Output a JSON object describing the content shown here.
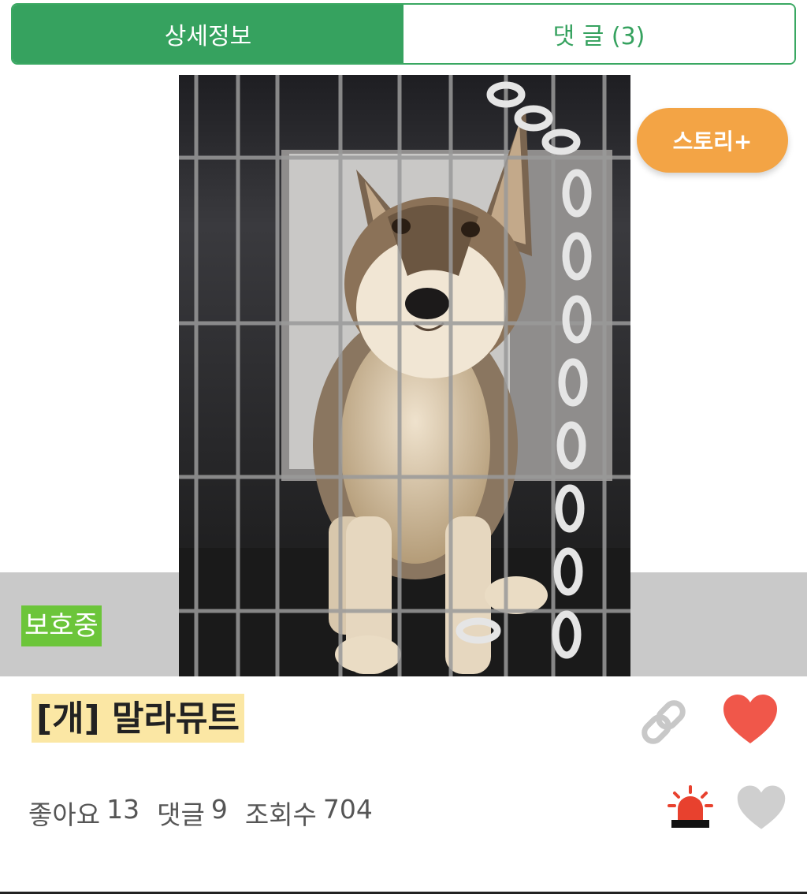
{
  "tabs": [
    {
      "label": "상세정보",
      "active": true
    },
    {
      "label": "댓 글 (3)",
      "active": false
    }
  ],
  "story_button": {
    "label": "스토리+"
  },
  "status_badge": {
    "label": "보호중"
  },
  "animal": {
    "title": "[개] 말라뮤트"
  },
  "stats": {
    "likes_label": "좋아요",
    "likes_count": "13",
    "comments_label": "댓글",
    "comments_count": "9",
    "views_label": "조회수",
    "views_count": "704"
  },
  "colors": {
    "brand_green": "#36a25f",
    "story_orange": "#f3a445",
    "badge_green": "#6cc53a",
    "heart_red": "#f0574a",
    "title_highlight": "#fbe7a4"
  },
  "icons": [
    "link-icon",
    "heart-icon",
    "siren-icon",
    "heart-outline-icon"
  ]
}
